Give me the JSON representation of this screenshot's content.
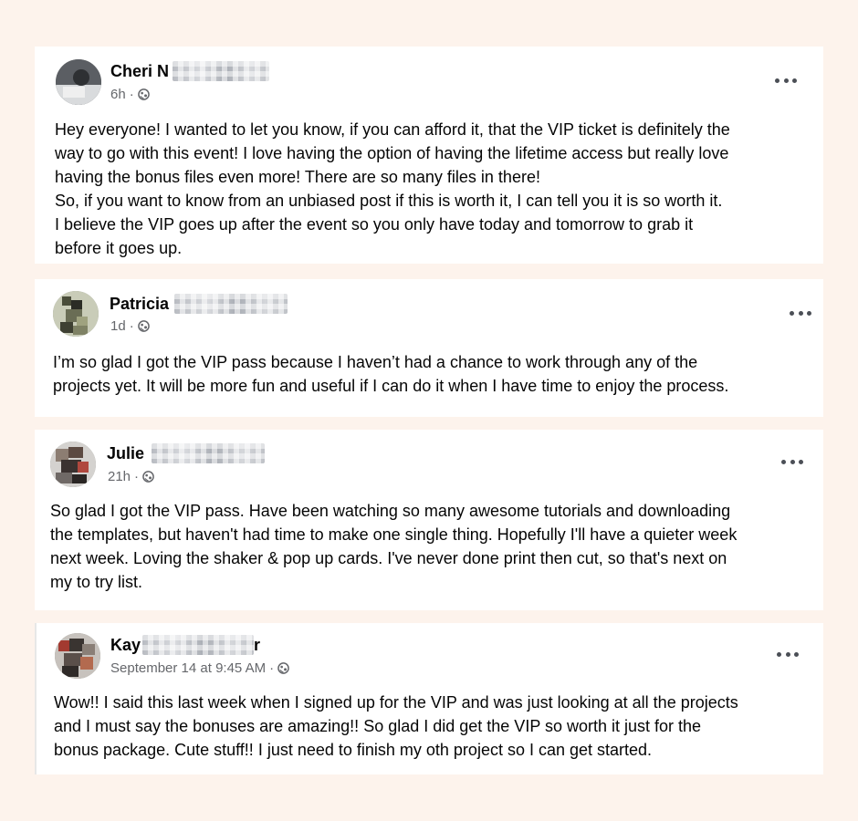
{
  "posts": [
    {
      "name": "Cheri N",
      "time": "6h",
      "separator": "·",
      "lines": [
        "Hey everyone! I wanted to let you know, if you can afford it, that the VIP ticket is definitely the",
        "way to go with this event! I love having the option of having the lifetime access but really love",
        "having the bonus files even more! There are so many files in there!",
        "So, if you want to know from an unbiased post if this is worth it, I can tell you it is so worth it.",
        "I believe the VIP goes up after the event so  you only have today and tomorrow to grab it",
        "before it goes up."
      ]
    },
    {
      "name": "Patricia",
      "time": "1d",
      "separator": "·",
      "lines": [
        "I’m so glad I got the VIP pass because I haven’t had a chance to work through any of the",
        "projects yet. It will be more fun and useful if I can do it when I have time to enjoy the process."
      ]
    },
    {
      "name": "Julie",
      "time": "21h",
      "separator": "·",
      "lines": [
        "So glad I got the VIP pass. Have been watching so many awesome tutorials and downloading",
        "the templates, but haven't had time to make one single thing. Hopefully I'll have a quieter week",
        "next week. Loving the shaker & pop up cards. I've never done print then cut, so that's next on",
        "my to try list."
      ]
    },
    {
      "name": "Kay",
      "name_tail": "r",
      "time": "September 14 at 9:45 AM",
      "separator": "·",
      "lines": [
        "Wow!! I said this last week when I signed up for the VIP and was just looking at all the projects",
        "and I must say the bonuses are amazing!! So glad I did get the VIP so worth it just for the",
        "bonus package. Cute stuff!! I just need to finish my oth project so I can get started."
      ]
    }
  ],
  "icons": {
    "more": "more-options-icon",
    "audience": "globe-icon"
  },
  "colors": {
    "background": "#fdf3ec",
    "card": "#ffffff",
    "meta_text": "#65676b"
  }
}
